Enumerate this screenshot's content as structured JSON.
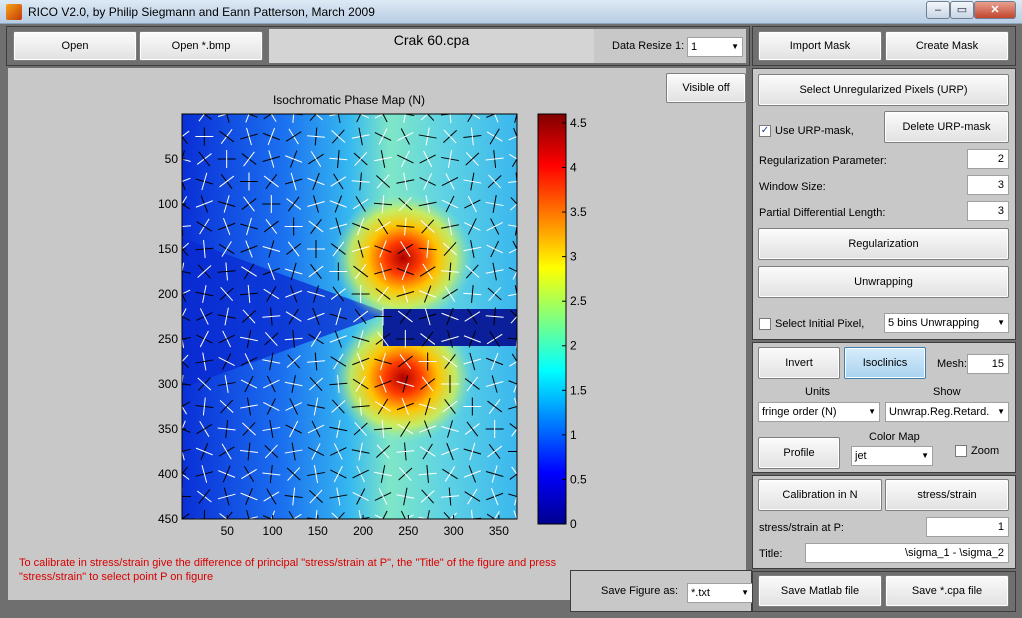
{
  "window": {
    "title": "RICO V2.0, by Philip Siegmann and Eann Patterson, March 2009"
  },
  "top_bar": {
    "open_label": "Open",
    "open_bmp_label": "Open *.bmp",
    "filename": "Crak 60.cpa",
    "data_resize_label": "Data Resize 1:",
    "data_resize_value": "1"
  },
  "mask": {
    "import_label": "Import Mask",
    "create_label": "Create Mask"
  },
  "plot": {
    "visible_off_label": "Visible off",
    "title": "Isochromatic Phase Map (N)",
    "x_ticks": [
      "50",
      "100",
      "150",
      "200",
      "250",
      "300",
      "350"
    ],
    "y_ticks": [
      "50",
      "100",
      "150",
      "200",
      "250",
      "300",
      "350",
      "400",
      "450"
    ],
    "colorbar_ticks": [
      "0",
      "0.5",
      "1",
      "1.5",
      "2",
      "2.5",
      "3",
      "3.5",
      "4",
      "4.5"
    ],
    "colormap": "jet"
  },
  "chart_data": {
    "type": "heatmap",
    "title": "Isochromatic Phase Map (N)",
    "xlim": [
      0,
      370
    ],
    "ylim": [
      450,
      0
    ],
    "colorbar_range": [
      0,
      4.6
    ],
    "x_ticks": [
      50,
      100,
      150,
      200,
      250,
      300,
      350
    ],
    "y_ticks": [
      50,
      100,
      150,
      200,
      250,
      300,
      350,
      400,
      450
    ],
    "crack": {
      "x_start": 222,
      "x_end": 370,
      "y_top": 217,
      "y_bottom": 257
    },
    "hotspots": [
      {
        "x": 250,
        "y": 205,
        "value": 4.5
      },
      {
        "x": 250,
        "y": 272,
        "value": 4.5
      }
    ],
    "overlay": "isoclinic direction arrows"
  },
  "note": {
    "line1": "To calibrate in stress/strain give the difference of principal \"stress/strain at P\", the \"Title\" of the figure and press",
    "line2": "\"stress/strain\" to select point P on figure"
  },
  "save_figure": {
    "label": "Save Figure as:",
    "value": "*.txt"
  },
  "regularization": {
    "select_urp_label": "Select Unregularized Pixels (URP)",
    "use_urp_label": "Use URP-mask,",
    "use_urp_checked": "✓",
    "delete_urp_label": "Delete URP-mask",
    "reg_param_label": "Regularization Parameter:",
    "reg_param_value": "2",
    "window_size_label": "Window Size:",
    "window_size_value": "3",
    "pdl_label": "Partial Differential Length:",
    "pdl_value": "3",
    "regularization_label": "Regularization",
    "unwrapping_label": "Unwrapping",
    "select_initial_label": "Select Initial Pixel,",
    "unwrap_mode": "5 bins Unwrapping"
  },
  "display": {
    "invert_label": "Invert",
    "isoclinics_label": "Isoclinics",
    "mesh_label": "Mesh:",
    "mesh_value": "15",
    "units_label": "Units",
    "units_value": "fringe order (N)",
    "show_label": "Show",
    "show_value": "Unwrap.Reg.Retard.",
    "profile_label": "Profile",
    "colormap_label": "Color Map",
    "colormap_value": "jet",
    "zoom_label": "Zoom"
  },
  "calibration": {
    "calibration_label": "Calibration in N",
    "stress_strain_label": "stress/strain",
    "at_p_label": "stress/strain at P:",
    "at_p_value": "1",
    "title_label": "Title:",
    "title_value": "\\sigma_1 - \\sigma_2"
  },
  "save": {
    "matlab_label": "Save Matlab file",
    "cpa_label": "Save *.cpa file"
  }
}
